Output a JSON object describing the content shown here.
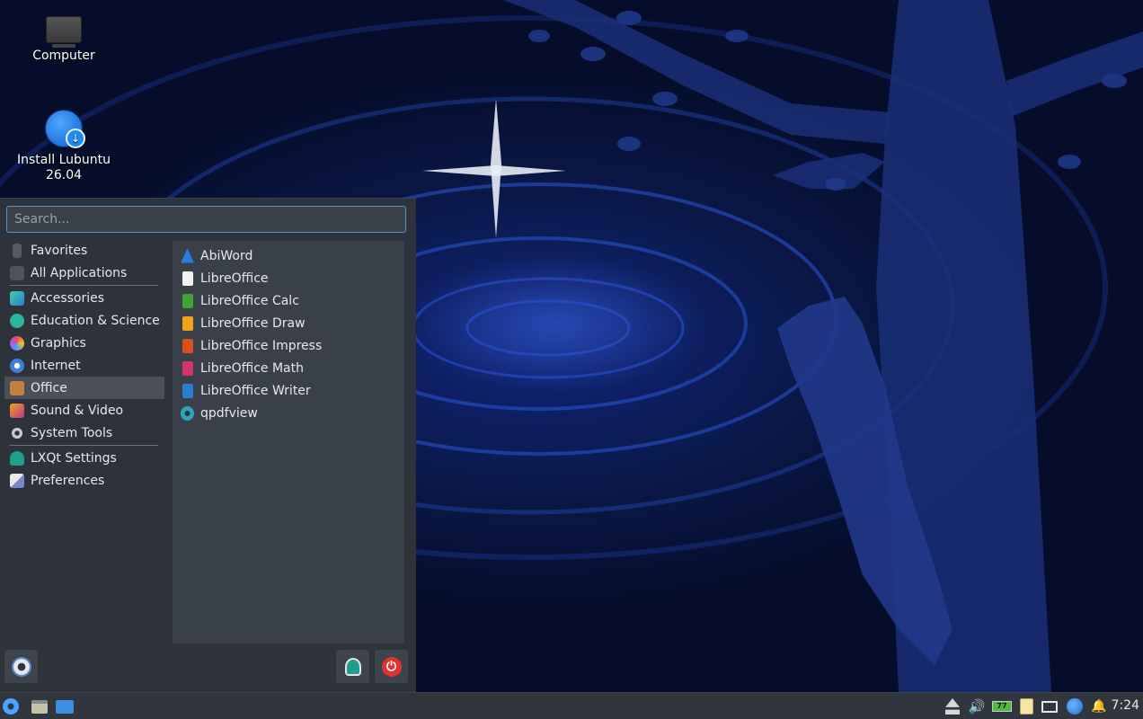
{
  "desktop": {
    "icons": [
      {
        "label": "Computer"
      },
      {
        "label": "Install Lubuntu\n26.04",
        "label_line1": "Install Lubuntu",
        "label_line2": "26.04"
      }
    ]
  },
  "menu": {
    "search_placeholder": "Search...",
    "categories": [
      {
        "label": "Favorites",
        "icon": "bookmark-icon"
      },
      {
        "label": "All Applications",
        "icon": "folder-icon"
      },
      {
        "label": "Accessories",
        "icon": "accessories-icon"
      },
      {
        "label": "Education & Science",
        "icon": "education-icon"
      },
      {
        "label": "Graphics",
        "icon": "graphics-icon"
      },
      {
        "label": "Internet",
        "icon": "internet-icon"
      },
      {
        "label": "Office",
        "icon": "office-icon",
        "selected": true
      },
      {
        "label": "Sound & Video",
        "icon": "multimedia-icon"
      },
      {
        "label": "System Tools",
        "icon": "system-tools-icon"
      },
      {
        "label": "LXQt Settings",
        "icon": "lxqt-settings-icon"
      },
      {
        "label": "Preferences",
        "icon": "preferences-icon"
      }
    ],
    "apps": [
      {
        "label": "AbiWord",
        "icon": "abiword-icon",
        "color": "#2a7de1"
      },
      {
        "label": "LibreOffice",
        "icon": "libreoffice-icon",
        "color": "#f2f2f2"
      },
      {
        "label": "LibreOffice Calc",
        "icon": "libreoffice-calc-icon",
        "color": "#3fa535"
      },
      {
        "label": "LibreOffice Draw",
        "icon": "libreoffice-draw-icon",
        "color": "#f0a31a"
      },
      {
        "label": "LibreOffice Impress",
        "icon": "libreoffice-impress-icon",
        "color": "#d8511d"
      },
      {
        "label": "LibreOffice Math",
        "icon": "libreoffice-math-icon",
        "color": "#d5336b"
      },
      {
        "label": "LibreOffice Writer",
        "icon": "libreoffice-writer-icon",
        "color": "#2f7dd0"
      },
      {
        "label": "qpdfview",
        "icon": "qpdfview-icon",
        "color": "#2aa7b8"
      }
    ],
    "bottom_buttons": {
      "left": "lubuntu-logo-icon",
      "settings": "lxqt-settings-icon",
      "power": "power-icon"
    }
  },
  "taskbar": {
    "start": "lubuntu-start-icon",
    "quicklaunch": [
      "file-manager-icon",
      "desktop-icon"
    ],
    "tray": [
      "eject-icon",
      "volume-icon",
      "battery-icon",
      "clipboard-icon",
      "network-icon",
      "update-icon",
      "notification-icon"
    ],
    "battery_label": "77",
    "clock": "7:24"
  },
  "colors": {
    "menu_bg": "#2e333b",
    "apps_bg": "#3a4049",
    "accent": "#4a95d8",
    "power_red": "#e0322e",
    "settings_teal": "#1f9e8e"
  }
}
